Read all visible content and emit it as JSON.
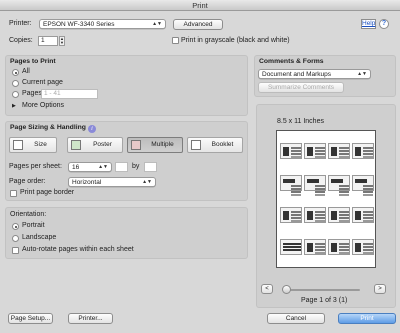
{
  "window": {
    "title": "Print"
  },
  "top": {
    "printer_label": "Printer:",
    "printer_value": "EPSON WF-3340 Series",
    "advanced_label": "Advanced",
    "help_label": "Help",
    "copies_label": "Copies:",
    "copies_value": "1",
    "grayscale_label": "Print in grayscale (black and white)"
  },
  "pages_to_print": {
    "title": "Pages to Print",
    "all_label": "All",
    "current_label": "Current page",
    "pages_label": "Pages",
    "pages_value": "1 - 41",
    "more_options_label": "More Options"
  },
  "comments": {
    "title": "Comments & Forms",
    "value": "Document and Markups",
    "summarize_label": "Summarize Comments"
  },
  "sizing": {
    "title": "Page Sizing & Handling",
    "buttons": [
      {
        "label": "Size"
      },
      {
        "label": "Poster"
      },
      {
        "label": "Multiple"
      },
      {
        "label": "Booklet"
      }
    ],
    "pages_per_sheet_label": "Pages per sheet:",
    "pages_per_sheet_value": "16",
    "by_label": "by",
    "page_order_label": "Page order:",
    "page_order_value": "Horizontal",
    "border_label": "Print page border"
  },
  "orientation": {
    "title": "Orientation:",
    "portrait_label": "Portrait",
    "landscape_label": "Landscape",
    "auto_rotate_label": "Auto-rotate pages within each sheet"
  },
  "preview": {
    "paper_size": "8.5 x 11 Inches",
    "page_status": "Page 1 of 3 (1)",
    "prev_label": "<",
    "next_label": ">"
  },
  "footer": {
    "page_setup_label": "Page Setup...",
    "printer_label": "Printer...",
    "cancel_label": "Cancel",
    "print_label": "Print"
  }
}
